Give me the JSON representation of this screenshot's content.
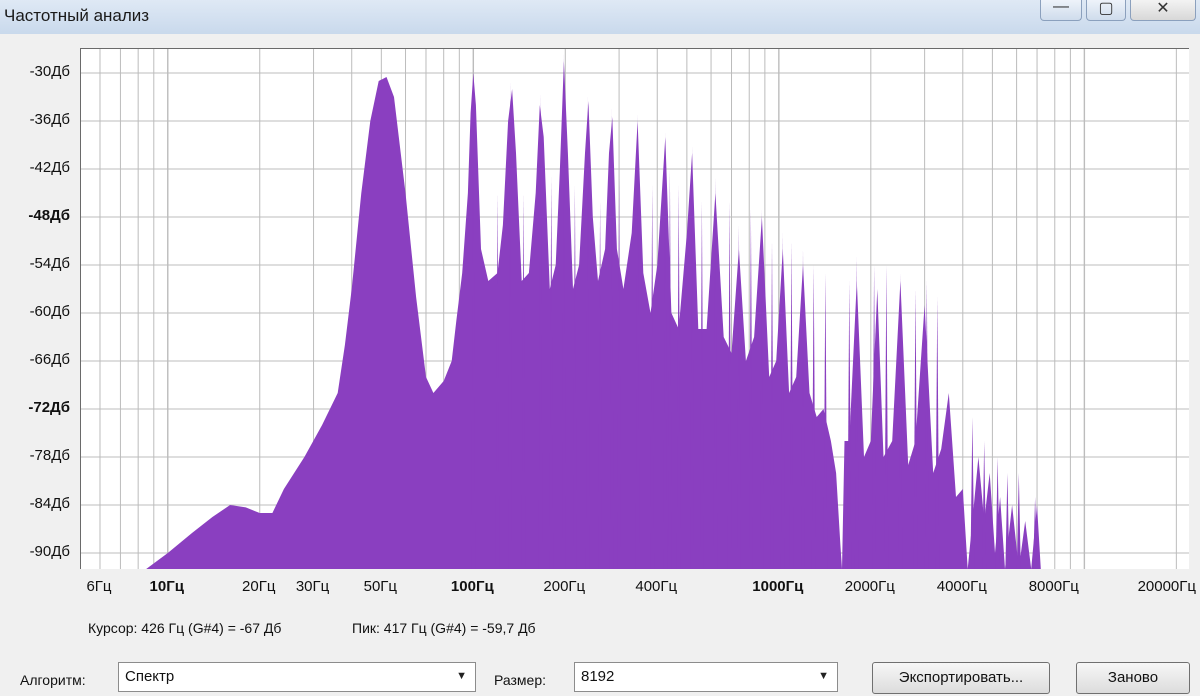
{
  "window": {
    "title": "Частотный анализ",
    "minimize_glyph": "—",
    "maximize_glyph": "▢",
    "close_glyph": "✕"
  },
  "colors": {
    "spectrum_fill": "#8a3fc0",
    "grid": "#bcbcbc",
    "plot_bg": "#ffffff"
  },
  "chart_data": {
    "type": "area",
    "xscale": "log",
    "xlim_hz": [
      5.2,
      22000
    ],
    "ylim_db": [
      -92,
      -27
    ],
    "grid": true,
    "y_ticks": [
      {
        "label": "-30Дб",
        "value": -30,
        "bold": false
      },
      {
        "label": "-36Дб",
        "value": -36,
        "bold": false
      },
      {
        "label": "-42Дб",
        "value": -42,
        "bold": false
      },
      {
        "label": "-48Дб",
        "value": -48,
        "bold": true
      },
      {
        "label": "-54Дб",
        "value": -54,
        "bold": false
      },
      {
        "label": "-60Дб",
        "value": -60,
        "bold": false
      },
      {
        "label": "-66Дб",
        "value": -66,
        "bold": false
      },
      {
        "label": "-72Дб",
        "value": -72,
        "bold": true
      },
      {
        "label": "-78Дб",
        "value": -78,
        "bold": false
      },
      {
        "label": "-84Дб",
        "value": -84,
        "bold": false
      },
      {
        "label": "-90Дб",
        "value": -90,
        "bold": false
      }
    ],
    "x_ticks": [
      {
        "label": "6Гц",
        "value": 6,
        "bold": false
      },
      {
        "label": "10Гц",
        "value": 10,
        "bold": true
      },
      {
        "label": "20Гц",
        "value": 20,
        "bold": false
      },
      {
        "label": "30Гц",
        "value": 30,
        "bold": false
      },
      {
        "label": "50Гц",
        "value": 50,
        "bold": false
      },
      {
        "label": "100Гц",
        "value": 100,
        "bold": true
      },
      {
        "label": "200Гц",
        "value": 200,
        "bold": false
      },
      {
        "label": "400Гц",
        "value": 400,
        "bold": false
      },
      {
        "label": "1000Гц",
        "value": 1000,
        "bold": true
      },
      {
        "label": "2000Гц",
        "value": 2000,
        "bold": false
      },
      {
        "label": "4000Гц",
        "value": 4000,
        "bold": false
      },
      {
        "label": "8000Гц",
        "value": 8000,
        "bold": false
      },
      {
        "label": "20000Гц",
        "value": 20000,
        "bold": false
      }
    ],
    "envelope": [
      [
        8.5,
        -92
      ],
      [
        10,
        -90
      ],
      [
        12,
        -87.5
      ],
      [
        14,
        -85.5
      ],
      [
        16,
        -84
      ],
      [
        18,
        -84.3
      ],
      [
        20,
        -85
      ],
      [
        22,
        -85
      ],
      [
        24,
        -82
      ],
      [
        28,
        -78
      ],
      [
        32,
        -74
      ],
      [
        36,
        -70
      ],
      [
        38,
        -64
      ],
      [
        40,
        -57
      ],
      [
        43,
        -45
      ],
      [
        46,
        -36
      ],
      [
        49,
        -31
      ],
      [
        52,
        -30.5
      ],
      [
        55,
        -33
      ],
      [
        60,
        -45
      ],
      [
        65,
        -58
      ],
      [
        70,
        -68
      ],
      [
        74,
        -70
      ],
      [
        80,
        -68.5
      ],
      [
        85,
        -66
      ],
      [
        88,
        -61
      ],
      [
        92,
        -55
      ],
      [
        96,
        -45
      ],
      [
        98,
        -35
      ],
      [
        100,
        -30
      ],
      [
        102,
        -34
      ],
      [
        106,
        -52
      ],
      [
        112,
        -56
      ],
      [
        120,
        -55
      ],
      [
        125,
        -49
      ],
      [
        130,
        -36
      ],
      [
        134,
        -32
      ],
      [
        138,
        -40
      ],
      [
        144,
        -56
      ],
      [
        152,
        -55
      ],
      [
        160,
        -45
      ],
      [
        165,
        -34
      ],
      [
        170,
        -38
      ],
      [
        178,
        -57
      ],
      [
        186,
        -54
      ],
      [
        192,
        -42
      ],
      [
        198,
        -28.5
      ],
      [
        204,
        -40
      ],
      [
        212,
        -57
      ],
      [
        222,
        -54
      ],
      [
        232,
        -40
      ],
      [
        238,
        -33.5
      ],
      [
        246,
        -48
      ],
      [
        256,
        -56
      ],
      [
        270,
        -52
      ],
      [
        278,
        -40
      ],
      [
        285,
        -35.5
      ],
      [
        295,
        -52
      ],
      [
        310,
        -57
      ],
      [
        330,
        -50
      ],
      [
        345,
        -36
      ],
      [
        360,
        -55
      ],
      [
        380,
        -60
      ],
      [
        400,
        -54
      ],
      [
        425,
        -38
      ],
      [
        445,
        -60
      ],
      [
        470,
        -62
      ],
      [
        500,
        -50
      ],
      [
        520,
        -40
      ],
      [
        545,
        -62
      ],
      [
        580,
        -62
      ],
      [
        620,
        -45
      ],
      [
        660,
        -63
      ],
      [
        700,
        -65
      ],
      [
        740,
        -52
      ],
      [
        780,
        -66
      ],
      [
        830,
        -63
      ],
      [
        880,
        -48
      ],
      [
        930,
        -68
      ],
      [
        980,
        -66
      ],
      [
        1030,
        -52
      ],
      [
        1080,
        -70
      ],
      [
        1140,
        -68
      ],
      [
        1200,
        -54
      ],
      [
        1260,
        -70
      ],
      [
        1330,
        -73
      ],
      [
        1400,
        -72
      ],
      [
        1480,
        -76
      ],
      [
        1540,
        -80
      ],
      [
        1590,
        -89
      ],
      [
        1610,
        -92
      ],
      [
        1640,
        -76
      ],
      [
        1700,
        -76
      ],
      [
        1800,
        -56
      ],
      [
        1900,
        -78
      ],
      [
        2000,
        -76
      ],
      [
        2100,
        -57
      ],
      [
        2200,
        -78
      ],
      [
        2350,
        -76
      ],
      [
        2500,
        -56
      ],
      [
        2650,
        -79
      ],
      [
        2800,
        -76
      ],
      [
        3000,
        -59
      ],
      [
        3200,
        -80
      ],
      [
        3400,
        -77
      ],
      [
        3600,
        -70
      ],
      [
        3800,
        -83
      ],
      [
        4000,
        -82
      ],
      [
        4150,
        -92
      ],
      [
        4300,
        -86
      ],
      [
        4500,
        -78
      ],
      [
        4700,
        -86
      ],
      [
        4900,
        -80
      ],
      [
        5100,
        -90
      ],
      [
        5300,
        -83
      ],
      [
        5500,
        -92
      ],
      [
        5800,
        -84
      ],
      [
        6100,
        -92
      ],
      [
        6400,
        -86
      ],
      [
        6700,
        -92
      ],
      [
        7000,
        -84
      ],
      [
        7200,
        -92
      ]
    ],
    "spikes": [
      [
        100,
        -29.5
      ],
      [
        120,
        -45
      ],
      [
        132,
        -31
      ],
      [
        146,
        -45
      ],
      [
        166,
        -32.5
      ],
      [
        180,
        -43
      ],
      [
        198,
        -27.5
      ],
      [
        215,
        -44
      ],
      [
        237,
        -33
      ],
      [
        260,
        -46
      ],
      [
        284,
        -34.5
      ],
      [
        300,
        -43
      ],
      [
        345,
        -35
      ],
      [
        385,
        -44
      ],
      [
        425,
        -37.5
      ],
      [
        440,
        -42
      ],
      [
        470,
        -44
      ],
      [
        520,
        -39
      ],
      [
        560,
        -46
      ],
      [
        620,
        -43
      ],
      [
        690,
        -46
      ],
      [
        740,
        -49
      ],
      [
        810,
        -47
      ],
      [
        880,
        -47
      ],
      [
        950,
        -51
      ],
      [
        1030,
        -50
      ],
      [
        1100,
        -51
      ],
      [
        1200,
        -52
      ],
      [
        1300,
        -54
      ],
      [
        1420,
        -55
      ],
      [
        1700,
        -56
      ],
      [
        1800,
        -53
      ],
      [
        2050,
        -54
      ],
      [
        2250,
        -54
      ],
      [
        2500,
        -55
      ],
      [
        2800,
        -57
      ],
      [
        3050,
        -56
      ],
      [
        3300,
        -58
      ],
      [
        4300,
        -73
      ],
      [
        4700,
        -76
      ],
      [
        5200,
        -78
      ],
      [
        5600,
        -80
      ],
      [
        6100,
        -80
      ],
      [
        6900,
        -83
      ]
    ]
  },
  "status": {
    "cursor_text": "Курсор: 426 Гц (G#4) = -67 Дб",
    "peak_text": "Пик: 417 Гц (G#4) = -59,7 Дб"
  },
  "controls": {
    "algorithm_label": "Алгоритм:",
    "algorithm_value": "Спектр",
    "size_label": "Размер:",
    "size_value": "8192",
    "export_button": "Экспортировать...",
    "redo_button": "Заново"
  }
}
